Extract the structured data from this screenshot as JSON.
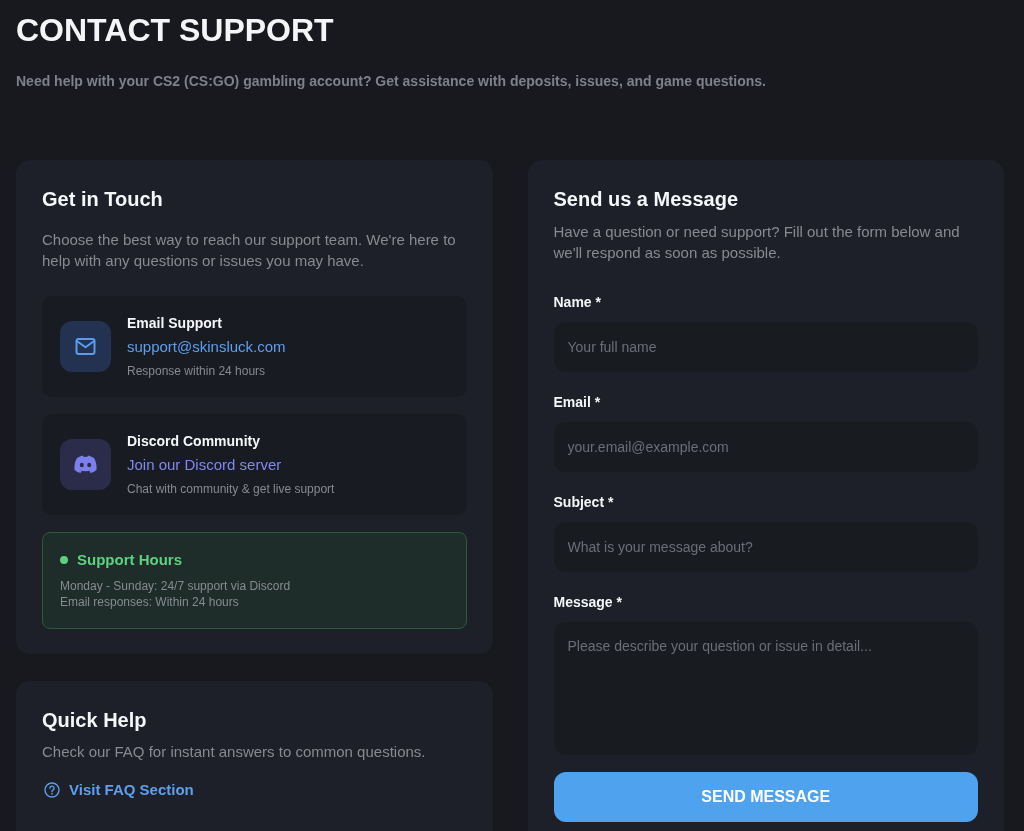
{
  "header": {
    "title": "CONTACT SUPPORT",
    "subtitle": "Need help with your CS2 (CS:GO) gambling account? Get assistance with deposits, issues, and game questions."
  },
  "contact_card": {
    "title": "Get in Touch",
    "description": "Choose the best way to reach our support team. We're here to help with any questions or issues you may have.",
    "channels": [
      {
        "kind": "email",
        "title": "Email Support",
        "link": "support@skinsluck.com",
        "note": "Response within 24 hours"
      },
      {
        "kind": "discord",
        "title": "Discord Community",
        "link": "Join our Discord server",
        "note": "Chat with community & get live support"
      }
    ],
    "hours": {
      "title": "Support Hours",
      "lines": [
        "Monday - Sunday: 24/7 support via Discord",
        "Email responses: Within 24 hours"
      ]
    }
  },
  "quick_help": {
    "title": "Quick Help",
    "description": "Check our FAQ for instant answers to common questions.",
    "link": "Visit FAQ Section"
  },
  "message_form": {
    "title": "Send us a Message",
    "description": "Have a question or need support? Fill out the form below and we'll respond as soon as possible.",
    "fields": [
      {
        "kind": "input",
        "label": "Name *",
        "placeholder": "Your full name"
      },
      {
        "kind": "input",
        "label": "Email *",
        "placeholder": "your.email@example.com"
      },
      {
        "kind": "input",
        "label": "Subject *",
        "placeholder": "What is your message about?"
      },
      {
        "kind": "textarea",
        "label": "Message *",
        "placeholder": "Please describe your question or issue in detail..."
      }
    ],
    "submit": "SEND MESSAGE"
  }
}
